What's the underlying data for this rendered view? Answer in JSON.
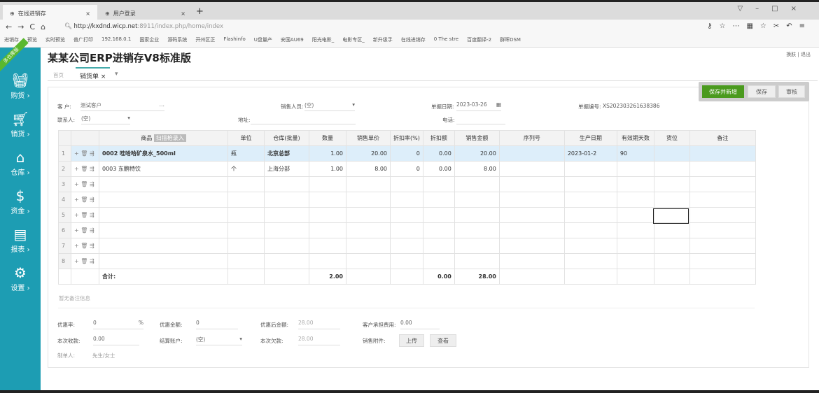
{
  "browser": {
    "tabs": [
      {
        "label": "在线进销存"
      },
      {
        "label": "用户登录"
      }
    ],
    "url_host": "http://kxdnd.wicp.net",
    "url_rest": ":8911/index.php/home/index",
    "bookmarks": [
      "进销存",
      "预览",
      "实时预览",
      "普广打印",
      "192.168.0.1",
      "国家企业",
      "源码系统",
      "开州区正",
      "Flashinfo",
      "U盘量产",
      "安国AU69",
      "阳光电影_",
      "电影专区_",
      "新升级手",
      "在线进销存",
      "0 The stre",
      "百度翻译-2",
      "群晖DSM"
    ]
  },
  "app": {
    "title": "某某公司ERP进销存V8标准版",
    "corner_badge": "多仓库版",
    "top_links": [
      "换肤",
      "退出"
    ],
    "tabs": [
      {
        "label": "首页"
      },
      {
        "label": "销货单"
      }
    ],
    "sidebar": [
      {
        "label": "购货",
        "icon": "basket-icon"
      },
      {
        "label": "销货",
        "icon": "cart-icon"
      },
      {
        "label": "仓库",
        "icon": "home-icon"
      },
      {
        "label": "资金",
        "icon": "dollar-icon"
      },
      {
        "label": "报表",
        "icon": "report-icon"
      },
      {
        "label": "设置",
        "icon": "gear-icon"
      }
    ]
  },
  "actions": {
    "save_new": "保存并新增",
    "save": "保存",
    "audit": "审核"
  },
  "form": {
    "customer_label": "客  户:",
    "customer": "测试客户",
    "salesperson_label": "销售人员:",
    "salesperson": "(空)",
    "date_label": "单据日期:",
    "date": "2023-03-26",
    "number_label": "单据编号:",
    "number": "XS202303261638386",
    "contact_label": "联系人:",
    "contact": "(空)",
    "address_label": "地址:",
    "phone_label": "电话:"
  },
  "table": {
    "headers": [
      "",
      "",
      "商品",
      "单位",
      "仓库(批量)",
      "数量",
      "销售单价",
      "折扣率(%)",
      "折扣额",
      "销售金额",
      "序列号",
      "生产日期",
      "有效期天数",
      "货位",
      "备注"
    ],
    "scan_label": "扫描枪录入",
    "rows": [
      {
        "n": "1",
        "product": "0002 哇哈哈矿泉水_500ml",
        "unit": "瓶",
        "warehouse": "北京总部",
        "qty": "1.00",
        "price": "20.00",
        "rate": "0",
        "discount": "0.00",
        "amount": "20.00",
        "serial": "",
        "date": "2023-01-2",
        "days": "90",
        "loc": "",
        "note": ""
      },
      {
        "n": "2",
        "product": "0003 东鹏特饮",
        "unit": "个",
        "warehouse": "上海分部",
        "qty": "1.00",
        "price": "8.00",
        "rate": "0",
        "discount": "0.00",
        "amount": "8.00",
        "serial": "",
        "date": "",
        "days": "",
        "loc": "",
        "note": ""
      },
      {
        "n": "3"
      },
      {
        "n": "4"
      },
      {
        "n": "5"
      },
      {
        "n": "6"
      },
      {
        "n": "7"
      },
      {
        "n": "8"
      }
    ],
    "total_label": "合计:",
    "total_qty": "2.00",
    "total_discount": "0.00",
    "total_amount": "28.00"
  },
  "remark_placeholder": "暂无备注信息",
  "footer": {
    "disc_rate_label": "优惠率:",
    "disc_rate": "0",
    "pct": "%",
    "disc_amt_label": "优惠金额:",
    "disc_amt": "0",
    "after_label": "优惠后金额:",
    "after": "28.00",
    "cust_fee_label": "客户承担费用:",
    "cust_fee": "0.00",
    "received_label": "本次收款:",
    "received": "0.00",
    "account_label": "结算账户:",
    "account": "(空)",
    "debt_label": "本次欠款:",
    "debt": "28.00",
    "attach_label": "销售附件:",
    "upload": "上传",
    "view": "查看",
    "maker_label": "制单人:",
    "maker": "先生/女士"
  },
  "colors": {
    "sidebar": "#1d9db3",
    "primary": "#4a9a1e"
  }
}
